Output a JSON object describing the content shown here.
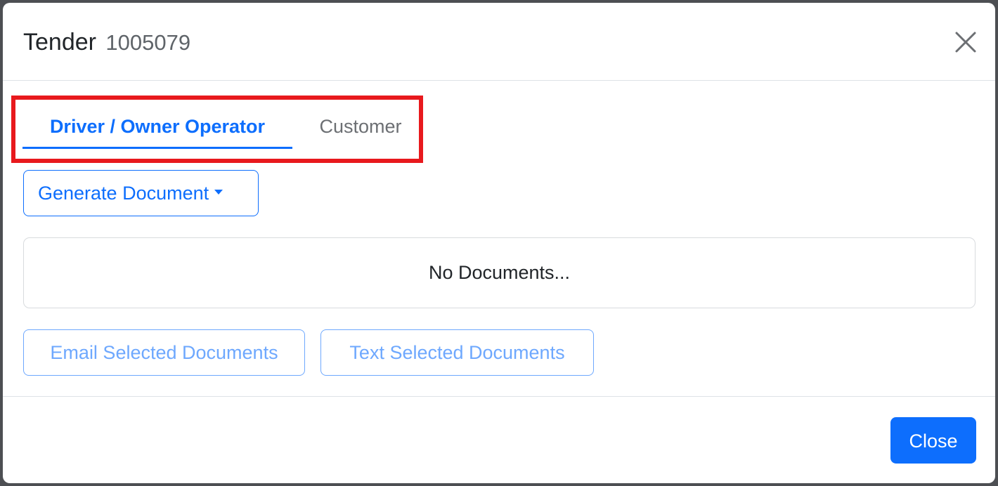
{
  "modal": {
    "title": "Tender",
    "tender_number": "1005079",
    "close_icon": "close-icon"
  },
  "tabs": [
    {
      "label": "Driver / Owner Operator",
      "active": true
    },
    {
      "label": "Customer",
      "active": false
    }
  ],
  "highlight_color": "#e8191d",
  "accent_color": "#0d6efd",
  "actions": {
    "generate_label": "Generate Document",
    "email_label": "Email Selected Documents",
    "text_label": "Text Selected Documents"
  },
  "documents": {
    "empty_text": "No Documents..."
  },
  "footer": {
    "close_label": "Close"
  }
}
